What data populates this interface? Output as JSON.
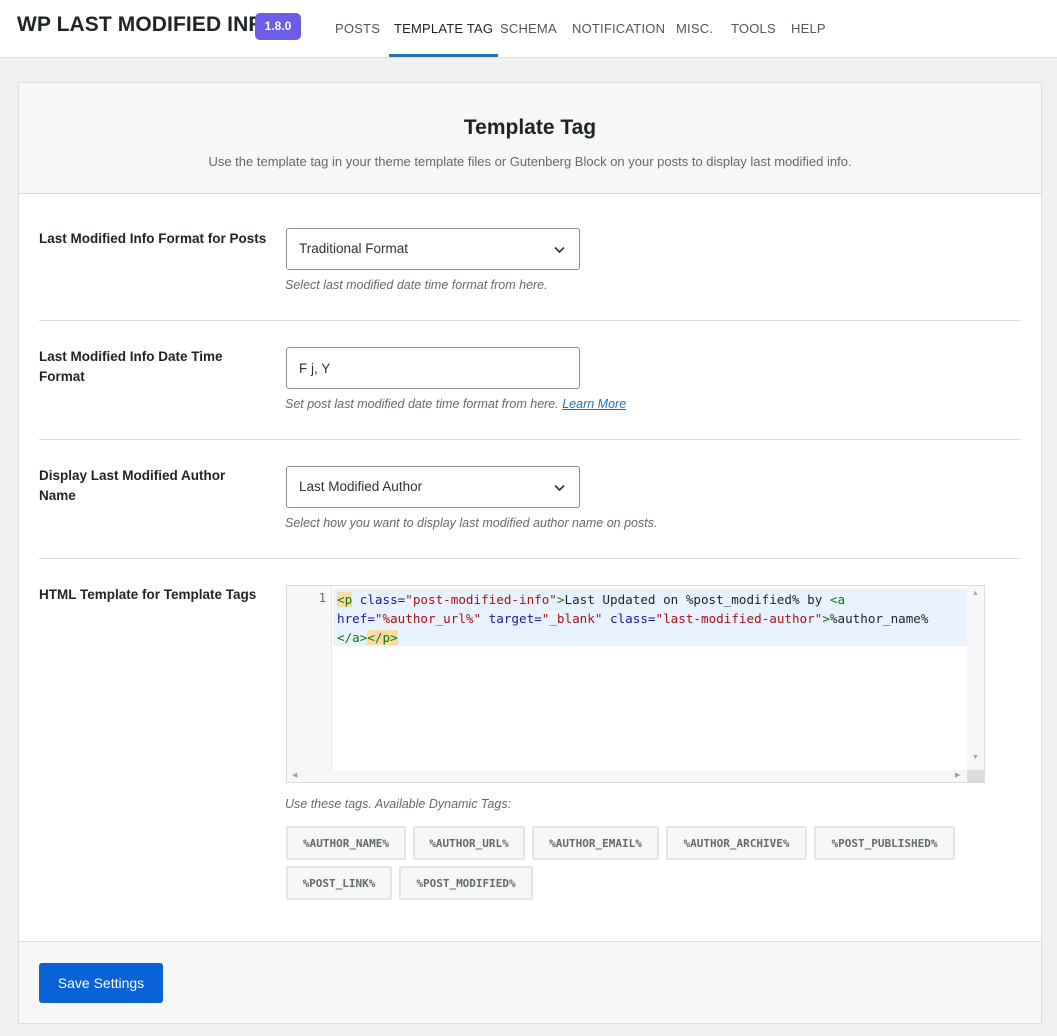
{
  "app": {
    "title": "WP LAST MODIFIED INFO",
    "version": "1.8.0"
  },
  "nav": [
    {
      "label": "POSTS",
      "active": false
    },
    {
      "label": "TEMPLATE TAG",
      "active": true
    },
    {
      "label": "SCHEMA",
      "active": false
    },
    {
      "label": "NOTIFICATION",
      "active": false
    },
    {
      "label": "MISC.",
      "active": false
    },
    {
      "label": "TOOLS",
      "active": false
    },
    {
      "label": "HELP",
      "active": false
    }
  ],
  "panel": {
    "title": "Template Tag",
    "description": "Use the template tag in your theme template files or Gutenberg Block on your posts to display last modified info."
  },
  "fields": {
    "format": {
      "label": "Last Modified Info Format for Posts",
      "value": "Traditional Format",
      "description": "Select last modified date time format from here."
    },
    "datetime": {
      "label": "Last Modified Info Date Time Format",
      "value": "F j, Y",
      "description": "Set post last modified date time format from here.",
      "link": "Learn More"
    },
    "author": {
      "label": "Display Last Modified Author Name",
      "value": "Last Modified Author",
      "description": "Select how you want to display last modified author name on posts."
    },
    "template": {
      "label": "HTML Template for Template Tags",
      "line_number": "1",
      "code": {
        "t1": "<p",
        "a1": " class=",
        "s1": "\"post-modified-info\"",
        "t2": ">",
        "txt1": "Last Updated on %post_modified% by ",
        "t3": "<a",
        "a2": "href=",
        "s2": "\"%author_url%\"",
        "a3": " target=",
        "s3": "\"_blank\"",
        "a4": " class=",
        "s4": "\"last-modified-author\"",
        "t4": ">",
        "txt2": "%author_name%",
        "t5": "</a>",
        "t6": "</p>"
      },
      "tags_label": "Use these tags. Available Dynamic Tags:",
      "tags": [
        "%AUTHOR_NAME%",
        "%AUTHOR_URL%",
        "%AUTHOR_EMAIL%",
        "%AUTHOR_ARCHIVE%",
        "%POST_PUBLISHED%",
        "%POST_LINK%",
        "%POST_MODIFIED%"
      ]
    }
  },
  "footer": {
    "save_label": "Save Settings"
  },
  "colors": {
    "accent": "#2271b1",
    "badge": "#6c5ce7",
    "button": "#0b62d6"
  },
  "icons": {
    "select_chevron": "chevron-down-icon"
  }
}
